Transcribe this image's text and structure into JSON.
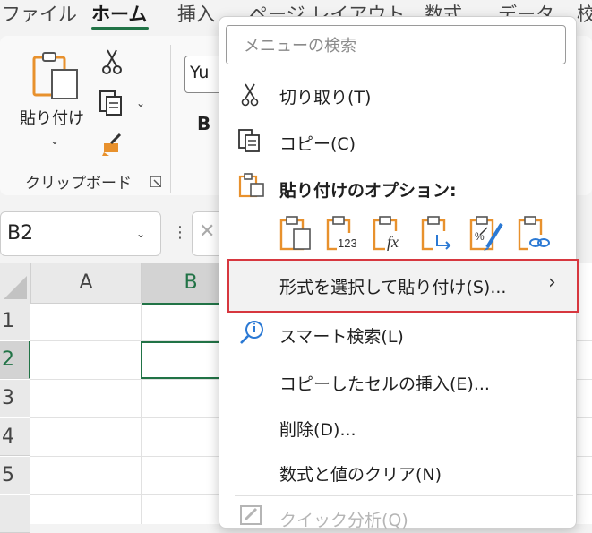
{
  "ribbon_tabs": [
    {
      "label": "ファイル"
    },
    {
      "label": "ホーム"
    },
    {
      "label": "挿入"
    },
    {
      "label": "ページ レイアウト"
    },
    {
      "label": "数式"
    },
    {
      "label": "データ"
    },
    {
      "label": "校"
    }
  ],
  "clipboard": {
    "paste_label": "貼り付け",
    "group_label": "クリップボード"
  },
  "font": {
    "name": "Yu",
    "bold": "B"
  },
  "name_box": {
    "value": "B2"
  },
  "grid": {
    "columns": [
      "A",
      "B"
    ],
    "rows": [
      "1",
      "2",
      "3",
      "4",
      "5"
    ],
    "selected_cell": "B2"
  },
  "context_menu": {
    "search_placeholder": "メニューの検索",
    "cut": "切り取り(T)",
    "copy": "コピー(C)",
    "paste_options_heading": "貼り付けのオプション:",
    "paste_special": "形式を選択して貼り付け(S)...",
    "smart_lookup": "スマート検索(L)",
    "insert_copied_cells": "コピーしたセルの挿入(E)...",
    "delete": "削除(D)...",
    "clear_contents": "数式と値のクリア(N)",
    "quick_analysis": "クイック分析(Q)"
  },
  "colors": {
    "accent_green": "#217346",
    "highlight_red": "#d7373f",
    "icon_orange": "#e8912d"
  }
}
